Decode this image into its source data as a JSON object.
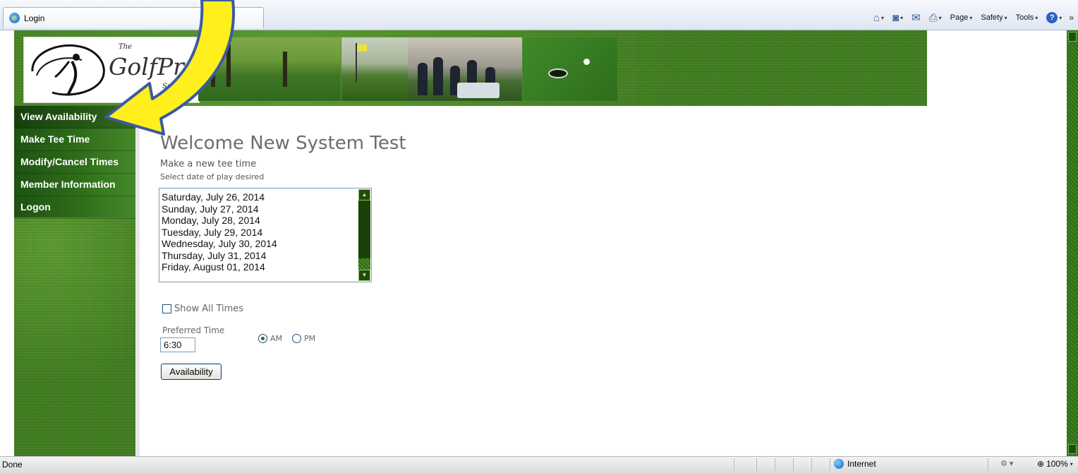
{
  "browser": {
    "tab_title": "Login",
    "commands": {
      "page": "Page",
      "safety": "Safety",
      "tools": "Tools",
      "help": "?"
    }
  },
  "logo": {
    "the": "The",
    "name": "GolfPro",
    "system": "System"
  },
  "nav": {
    "items": [
      {
        "label": "View Availability",
        "active": true
      },
      {
        "label": "Make Tee Time"
      },
      {
        "label": "Modify/Cancel Times"
      },
      {
        "label": "Member Information"
      },
      {
        "label": "Logon"
      }
    ]
  },
  "main": {
    "welcome": "Welcome New System Test",
    "subtitle": "Make a new tee time",
    "prompt": "Select date of play desired",
    "dates": [
      "Saturday, July 26, 2014",
      "Sunday, July 27, 2014",
      "Monday, July 28, 2014",
      "Tuesday, July 29, 2014",
      "Wednesday, July 30, 2014",
      "Thursday, July 31, 2014",
      "Friday, August 01, 2014"
    ],
    "show_all_label": "Show All Times",
    "preferred_label": "Preferred Time",
    "preferred_value": "6:30",
    "am_label": "AM",
    "pm_label": "PM",
    "selected_period": "AM",
    "button_label": "Availability"
  },
  "status": {
    "text": "Done",
    "zone": "Internet",
    "zoom": "100%"
  },
  "colors": {
    "nav_green": "#2e6e1a",
    "annotation_yellow": "#ffef1c",
    "annotation_outline": "#3b5aa0"
  }
}
